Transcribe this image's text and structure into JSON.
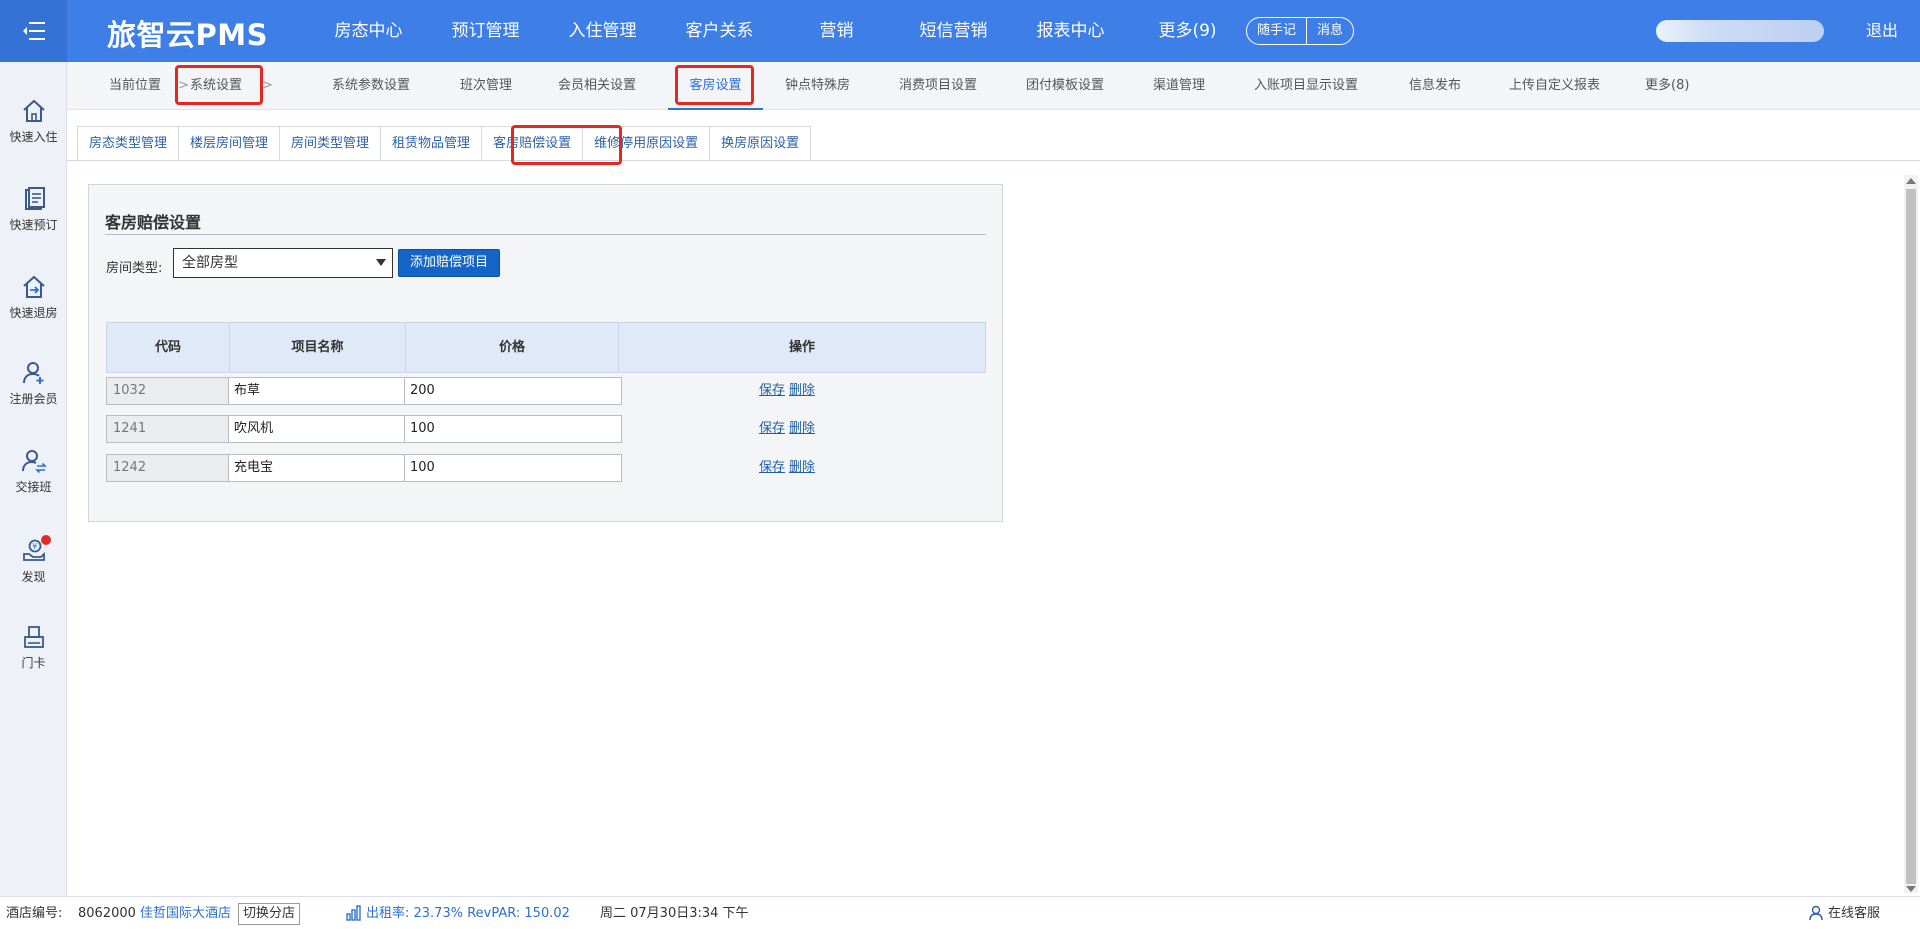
{
  "header": {
    "brand": "旅智云PMS",
    "nav": [
      "房态中心",
      "预订管理",
      "入住管理",
      "客户关系",
      "营销",
      "短信营销",
      "报表中心",
      "更多(9)"
    ],
    "note_button": "随手记",
    "message_button": "消息",
    "logout": "退出"
  },
  "sidebar": {
    "items": [
      {
        "label": "快速入住",
        "icon": "home-icon"
      },
      {
        "label": "快速预订",
        "icon": "booking-icon"
      },
      {
        "label": "快速退房",
        "icon": "checkout-icon"
      },
      {
        "label": "注册会员",
        "icon": "add-user-icon"
      },
      {
        "label": "交接班",
        "icon": "shift-handover-icon"
      },
      {
        "label": "发现",
        "icon": "discover-icon"
      },
      {
        "label": "门卡",
        "icon": "card-icon"
      }
    ]
  },
  "breadcrumb": {
    "current_label": "当前位置",
    "section": "系统设置"
  },
  "subnav": {
    "tabs": [
      "系统参数设置",
      "班次管理",
      "会员相关设置",
      "客房设置",
      "钟点特殊房",
      "消费项目设置",
      "团付模板设置",
      "渠道管理",
      "入账项目显示设置",
      "信息发布",
      "上传自定义报表",
      "更多(8)"
    ],
    "active": "客房设置"
  },
  "tabs": {
    "items": [
      "房态类型管理",
      "楼层房间管理",
      "房间类型管理",
      "租赁物品管理",
      "客房赔偿设置",
      "维修停用原因设置",
      "换房原因设置"
    ],
    "active": "客房赔偿设置"
  },
  "panel": {
    "title": "客房赔偿设置",
    "filter_label": "房间类型:",
    "filter_value": "全部房型",
    "add_button": "添加赔偿项目",
    "columns": [
      "代码",
      "项目名称",
      "价格",
      "操作"
    ],
    "rows": [
      {
        "code": "1032",
        "name": "布草",
        "price": "200"
      },
      {
        "code": "1241",
        "name": "吹风机",
        "price": "100"
      },
      {
        "code": "1242",
        "name": "充电宝",
        "price": "100"
      }
    ],
    "save_label": "保存",
    "delete_label": "删除"
  },
  "footer": {
    "hotel_no_label": "酒店编号:",
    "hotel_no": "8062000",
    "hotel_name": "佳哲国际大酒店",
    "switch_label": "切换分店",
    "occupancy": "出租率: 23.73% RevPAR: 150.02",
    "datetime": "周二 07月30日3:34 下午",
    "support": "在线客服"
  },
  "colors": {
    "header_bg": "#3d7fe6",
    "active_tab": "#2f6fd8",
    "highlight_box": "#e5281f",
    "primary_button": "#1565c8"
  }
}
